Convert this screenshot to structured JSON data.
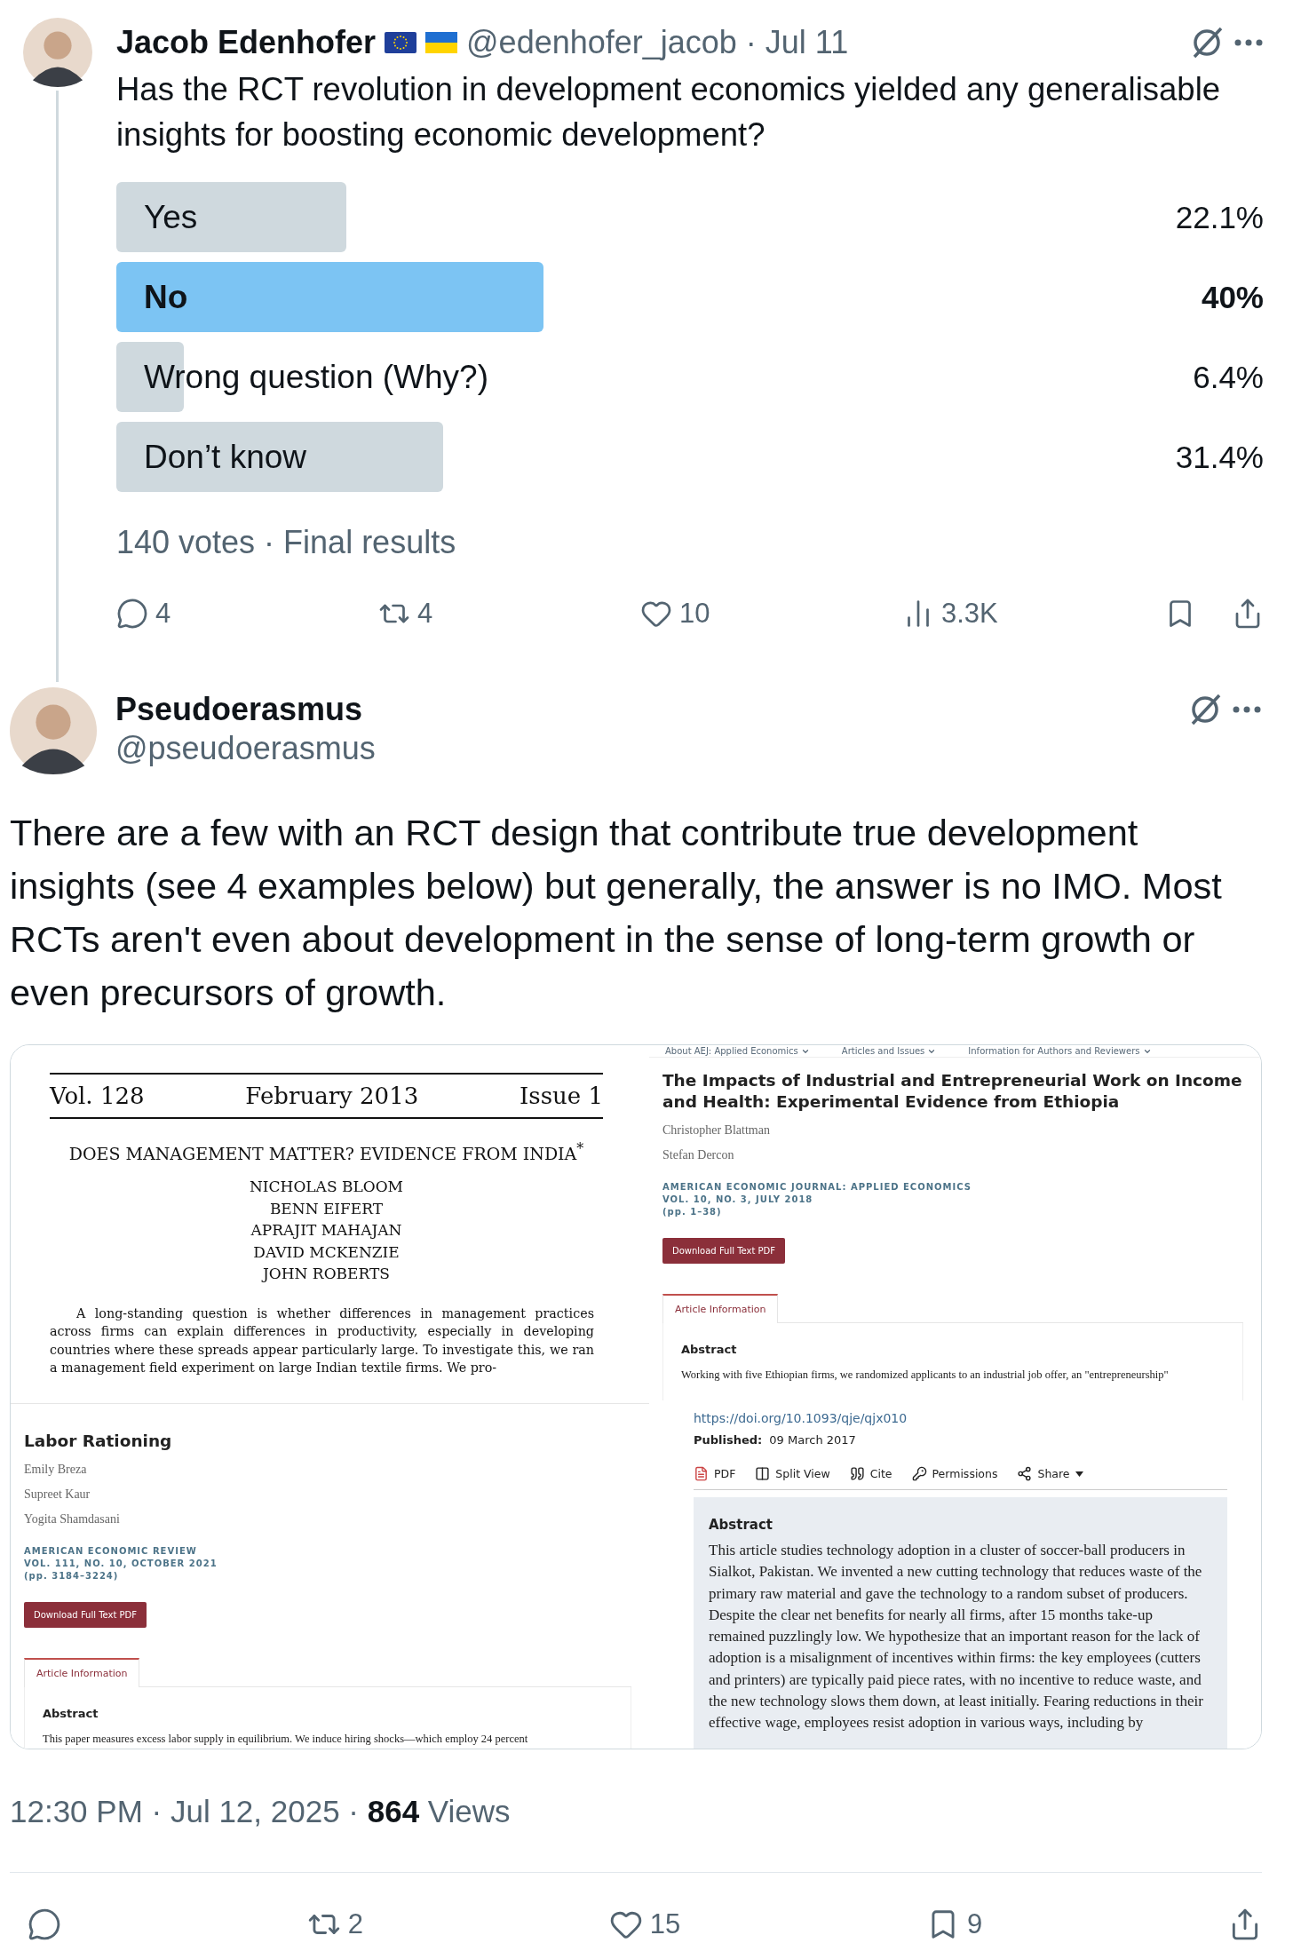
{
  "tweets": [
    {
      "author": "Jacob Edenhofer",
      "handle": "@edenhofer_jacob",
      "date": "· Jul 11",
      "text": "Has the RCT revolution in development economics yielded any generalisable insights for boosting economic development?",
      "poll": {
        "options": [
          {
            "label": "Yes",
            "percent": "22.1%",
            "leading": false
          },
          {
            "label": "No",
            "percent": "40%",
            "leading": true
          },
          {
            "label": "Wrong question (Why?)",
            "percent": "6.4%",
            "leading": false
          },
          {
            "label": "Don’t know",
            "percent": "31.4%",
            "leading": false
          }
        ],
        "summary": "140 votes · Final results"
      },
      "actions": [
        {
          "kind": "reply",
          "count": "4"
        },
        {
          "kind": "repost",
          "count": "4"
        },
        {
          "kind": "like",
          "count": "10"
        },
        {
          "kind": "views",
          "count": "3.3K"
        },
        {
          "kind": "bookmark"
        },
        {
          "kind": "share"
        }
      ]
    },
    {
      "author": "Pseudoerasmus",
      "handle": "@pseudoerasmus",
      "text": "There are a few with an RCT design that contribute true development insights (see 4 examples below) but generally, the answer is no IMO. Most RCTs aren't even about development in the sense of long-term growth or even precursors of growth.",
      "media": {
        "columns": [
          {
            "panels": [
              {
                "kind": "journal_page",
                "volume": "Vol. 128",
                "date": "February 2013",
                "issue": "Issue 1",
                "title": "DOES MANAGEMENT MATTER? EVIDENCE FROM INDIA$^{*}$",
                "authors": [
                  "NICHOLAS BLOOM",
                  "BENN EIFERT",
                  "APRAJIT MAHAJAN",
                  "DAVID MCKENZIE",
                  "JOHN ROBERTS"
                ],
                "abstract": "A long-standing question is whether differences in management practices across firms can explain differences in productivity, especially in developing countries where these spreads appear particularly large. To investigate this, we ran a management field experiment on large Indian textile firms. We pro-"
              },
              {
                "kind": "aea_page",
                "title": "Labor Rationing",
                "authors": [
                  "Emily Breza",
                  "Supreet Kaur",
                  "Yogita Shamdasani"
                ],
                "journal": "AMERICAN ECONOMIC REVIEW",
                "issue": "VOL. 111, NO. 10, OCTOBER 2021",
                "pages": "(pp. 3184–3224)",
                "button": "Download Full Text PDF",
                "tab": "Article Information",
                "abstract_heading": "Abstract",
                "abstract": "This paper measures excess labor supply in equilibrium. We induce hiring shocks—which employ 24 percent"
              }
            ]
          },
          {
            "panels": [
              {
                "kind": "aea_page",
                "nav": [
                  "About AEJ: Applied Economics",
                  "Articles and Issues",
                  "Information for Authors and Reviewers"
                ],
                "title": "The Impacts of Industrial and Entrepreneurial Work on Income and Health: Experimental Evidence from Ethiopia",
                "authors": [
                  "Christopher Blattman",
                  "Stefan Dercon"
                ],
                "journal": "AMERICAN ECONOMIC JOURNAL: APPLIED ECONOMICS",
                "issue": "VOL. 10, NO. 3, JULY 2018",
                "pages": "(pp. 1–38)",
                "button": "Download Full Text PDF",
                "tab": "Article Information",
                "abstract_heading": "Abstract",
                "abstract": "Working with five Ethiopian firms, we randomized applicants to an industrial job offer, an \"entrepreneurship\""
              },
              {
                "kind": "oup_page",
                "doi": "https://doi.org/10.1093/qje/qjx010",
                "published_label": "Published:",
                "published": "09 March 2017",
                "tools": [
                  {
                    "kind": "pdf",
                    "label": "PDF"
                  },
                  {
                    "kind": "split",
                    "label": "Split View"
                  },
                  {
                    "kind": "cite",
                    "label": "Cite"
                  },
                  {
                    "kind": "permissions",
                    "label": "Permissions"
                  },
                  {
                    "kind": "share",
                    "label": "Share"
                  }
                ],
                "abstract_heading": "Abstract",
                "abstract": "This article studies technology adoption in a cluster of soccer-ball producers in Sialkot, Pakistan. We invented a new cutting technology that reduces waste of the primary raw material and gave the technology to a random subset of producers. Despite the clear net benefits for nearly all firms, after 15 months take-up remained puzzlingly low. We hypothesize that an important reason for the lack of adoption is a misalignment of incentives within firms: the key employees (cutters and printers) are typically paid piece rates, with no incentive to reduce waste, and the new technology slows them down, at least initially. Fearing reductions in their effective wage, employees resist adoption in various ways, including by"
              }
            ]
          }
        ]
      },
      "timestamp": "12:30 PM · Jul 12, 2025 · **864** Views",
      "actions": [
        {
          "kind": "reply"
        },
        {
          "kind": "repost",
          "count": "2"
        },
        {
          "kind": "like",
          "count": "15"
        },
        {
          "kind": "bookmark",
          "count": "9"
        },
        {
          "kind": "share"
        }
      ]
    }
  ]
}
